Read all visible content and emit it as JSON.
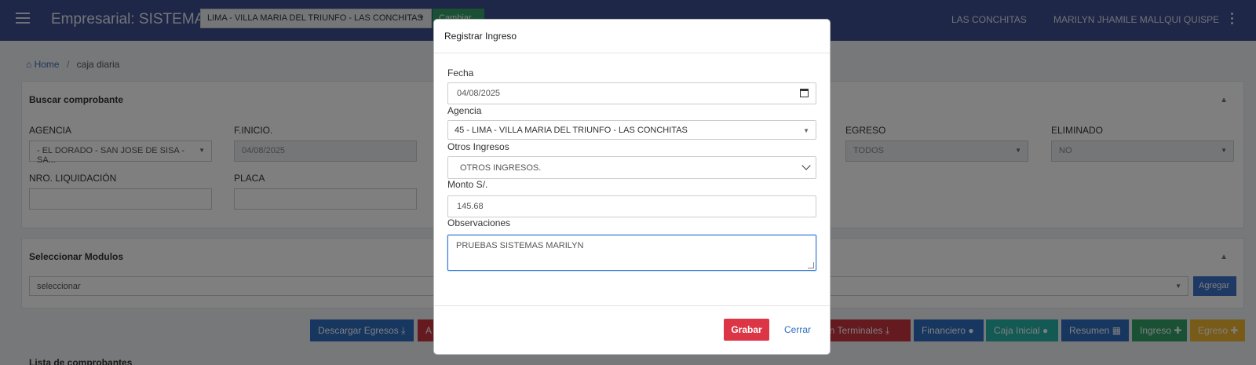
{
  "navbar": {
    "brand": "Empresarial: SISTEMAS",
    "agency_select": "LIMA - VILLA MARIA DEL TRIUNFO - LAS CONCHITAS",
    "cambiar_label": "Cambiar",
    "location": "LAS CONCHITAS",
    "user": "MARILYN JHAMILE MALLQUI QUISPE",
    "brand_color": "#3d4f8f"
  },
  "breadcrumb": {
    "home": "Home",
    "separator": "/",
    "current": "caja diaria"
  },
  "search_card": {
    "title": "Buscar comprobante",
    "agencia_label": "AGENCIA",
    "agencia_value": "- EL DORADO - SAN JOSE DE SISA - SA...",
    "f_inicio_label": "F.INICIO.",
    "f_inicio_value": "04/08/2025",
    "egreso_label": "EGRESO",
    "egreso_value": "TODOS",
    "eliminado_label": "ELIMINADO",
    "eliminado_value": "NO",
    "nro_liquidacion_label": "NRO. LIQUIDACIÓN",
    "placa_label": "PLACA"
  },
  "modules_card": {
    "title": "Seleccionar Modulos",
    "select_value": "seleccionar",
    "agregar_label": "Agregar"
  },
  "actions": {
    "descargar_egresos": "Descargar Egresos",
    "partial_a": "A",
    "resumen_terminales": "...en Terminales",
    "financiero": "Financiero",
    "caja_inicial": "Caja Inicial",
    "resumen": "Resumen",
    "ingreso": "Ingreso",
    "egreso": "Egreso"
  },
  "list_title": "Lista de comprobantes",
  "modal": {
    "title": "Registrar Ingreso",
    "fecha_label": "Fecha",
    "fecha_value": "04/08/2025",
    "agencia_label": "Agencia",
    "agencia_value": "45 - LIMA - VILLA MARIA DEL TRIUNFO - LAS CONCHITAS",
    "otros_label": "Otros Ingresos",
    "otros_value": "OTROS INGRESOS.",
    "monto_label": "Monto S/.",
    "monto_value": "145.68",
    "obs_label": "Observaciones",
    "obs_value": "PRUEBAS SISTEMAS MARILYN",
    "grabar_label": "Grabar",
    "cerrar_label": "Cerrar"
  }
}
